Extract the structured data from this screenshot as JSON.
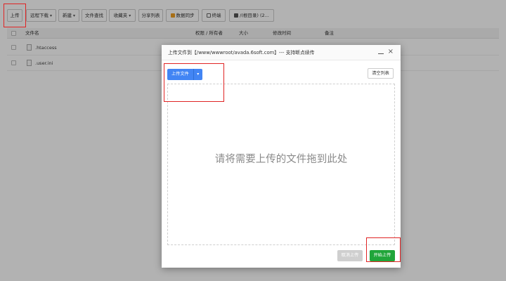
{
  "toolbar": {
    "upload": "上传",
    "remote_download": "远程下载",
    "new": "新建",
    "file_search": "文件查找",
    "favorites": "收藏夹",
    "share_list": "分享列表",
    "data_sync": "数据同步",
    "terminal": "终端",
    "root_dir": "/(根目录) (2..."
  },
  "list": {
    "headers": {
      "name": "文件名",
      "perm": "权限 / 所有者",
      "size": "大小",
      "mtime": "修改时间",
      "note": "备注"
    },
    "rows": [
      {
        "name": ".htaccess"
      },
      {
        "name": ".user.ini"
      }
    ]
  },
  "modal": {
    "title": "上传文件到【/www/wwwroot/avada.6soft.com】--- 支持断点续传",
    "upload_file": "上传文件",
    "clear_list": "清空列表",
    "drop_hint": "请将需要上传的文件拖到此处",
    "cancel": "取消上传",
    "start": "开始上传"
  },
  "colors": {
    "primary": "#4285f4",
    "success": "#20a53a",
    "highlight": "#e02424",
    "overlay": "rgba(0,0,0,0.30)"
  },
  "icons": [
    "caret-down-icon",
    "sync-icon",
    "terminal-icon",
    "drive-icon",
    "minimize-icon",
    "close-icon",
    "file-icon"
  ]
}
